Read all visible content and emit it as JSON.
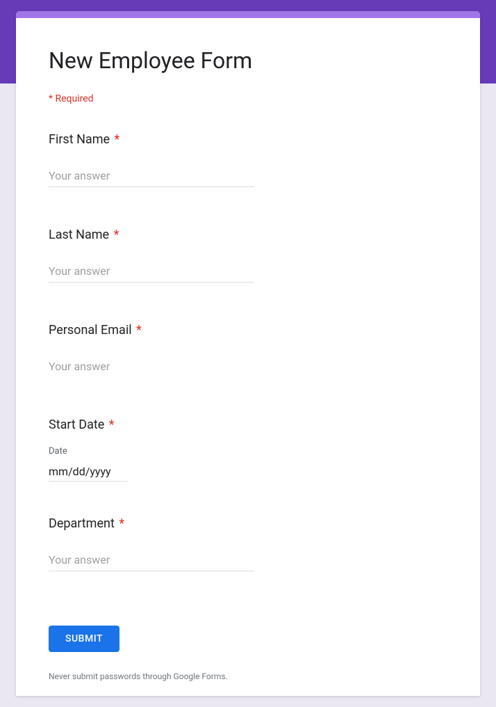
{
  "form": {
    "title": "New Employee Form",
    "required_label": "* Required",
    "footer_text": "Never submit passwords through Google Forms.",
    "submit_label": "SUBMIT"
  },
  "fields": {
    "first_name": {
      "label": "First Name",
      "placeholder": "Your answer"
    },
    "last_name": {
      "label": "Last Name",
      "placeholder": "Your answer"
    },
    "personal_email": {
      "label": "Personal Email",
      "placeholder": "Your answer"
    },
    "start_date": {
      "label": "Start Date",
      "sublabel": "Date",
      "value": "mm/dd/yyyy"
    },
    "department": {
      "label": "Department",
      "placeholder": "Your answer"
    }
  },
  "asterisk": "*"
}
